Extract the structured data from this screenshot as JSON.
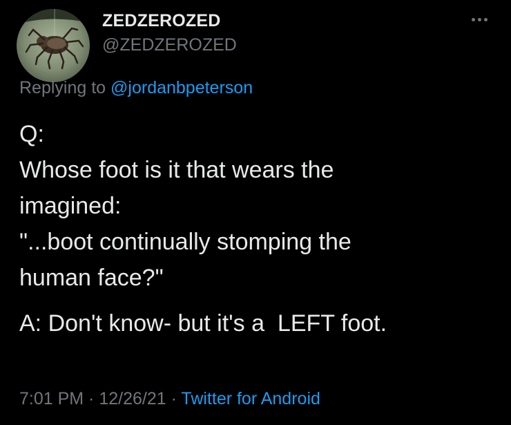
{
  "author": {
    "display_name": "ZEDZEROZED",
    "handle": "@ZEDZEROZED",
    "avatar_icon": "spider-avatar"
  },
  "reply": {
    "prefix": "Replying to ",
    "mention": "@jordanbpeterson"
  },
  "tweet": {
    "lines": [
      "Q:",
      "Whose foot is it that wears the",
      "imagined:",
      "\"...boot continually stomping the",
      "human face?\""
    ],
    "answer": "A: Don't know- but it's a  LEFT foot."
  },
  "meta": {
    "time": "7:01 PM",
    "separator": " · ",
    "date": "12/26/21",
    "separator2": " · ",
    "source": "Twitter for Android"
  },
  "icons": {
    "more": "more-horizontal-icon"
  },
  "colors": {
    "background": "#000000",
    "text": "#e7e9ea",
    "secondary": "#71767b",
    "link": "#1d9bf0"
  }
}
